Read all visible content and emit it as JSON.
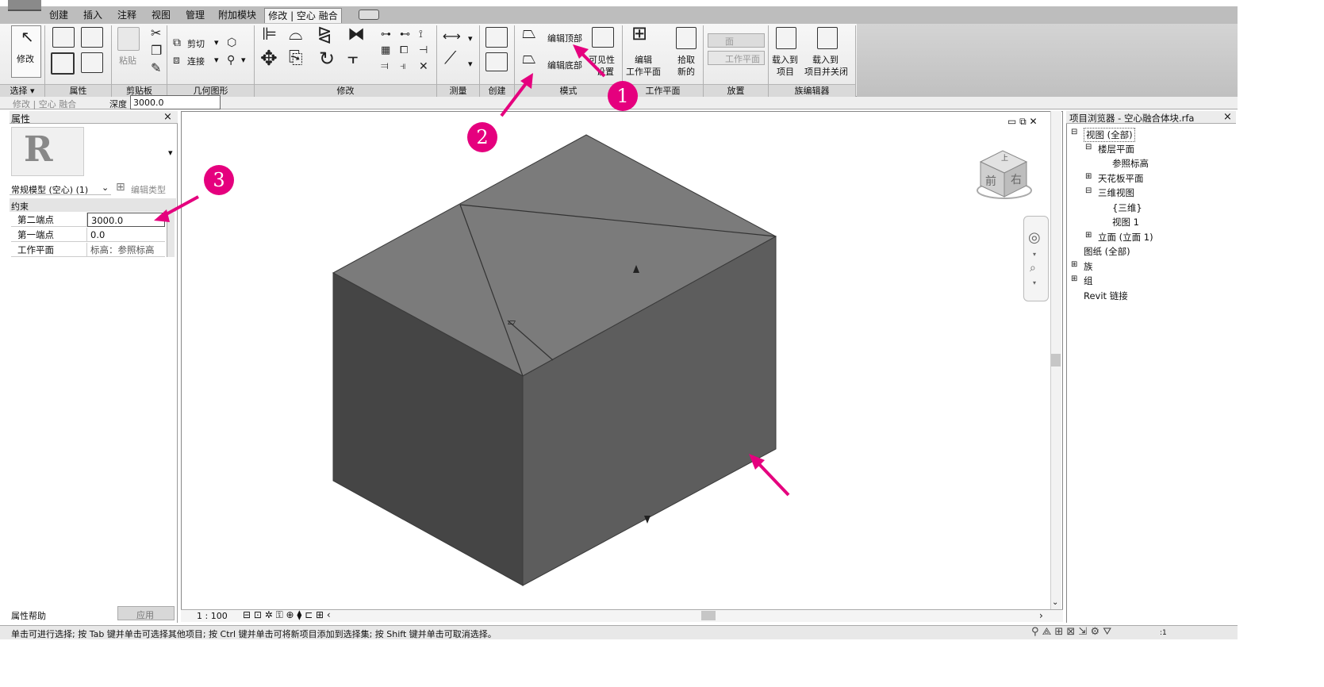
{
  "ribbon": {
    "tabs": [
      "创建",
      "插入",
      "注释",
      "视图",
      "管理",
      "附加模块",
      "修改 | 空心 融合"
    ],
    "buttons": {
      "modify": "修改",
      "paste": "粘贴",
      "cut": "剪切",
      "join": "连接",
      "edit_top": "编辑顶部",
      "edit_bottom": "编辑底部",
      "visibility": "可见性",
      "visibility_settings": "设置",
      "edit_workplane_1": "编辑",
      "edit_workplane_2": "工作平面",
      "pick_new_1": "拾取",
      "pick_new_2": "新的",
      "face": "面",
      "workplane_place": "工作平面",
      "load_project_1": "载入到",
      "load_project_2": "项目",
      "load_close_1": "载入到",
      "load_close_2": "项目并关闭"
    },
    "groups": {
      "select": "选择 ▾",
      "properties": "属性",
      "clipboard": "剪贴板",
      "geometry": "几何图形",
      "modify": "修改",
      "measure": "测量",
      "create": "创建",
      "mode": "模式",
      "workplane": "工作平面",
      "place": "放置",
      "family_editor": "族编辑器"
    }
  },
  "options_bar": {
    "context": "修改 | 空心 融合",
    "depth_label": "深度",
    "depth_value": "3000.0"
  },
  "properties": {
    "title": "属性",
    "close": "×",
    "type_selector": "常规模型 (空心) (1)",
    "edit_type": "编辑类型",
    "section": "约束",
    "rows": [
      {
        "name": "第二端点",
        "value": "3000.0"
      },
      {
        "name": "第一端点",
        "value": "0.0"
      },
      {
        "name": "工作平面",
        "value": "标高：参照标高"
      }
    ],
    "help": "属性帮助",
    "apply": "应用"
  },
  "viewport": {
    "window_controls": "▭ ⧉ ✕",
    "viewcube_top": "上",
    "viewcube_front": "前",
    "viewcube_right": "右",
    "scale": "1 : 100"
  },
  "browser": {
    "title": "项目浏览器 - 空心融合体块.rfa",
    "close": "×",
    "items": [
      {
        "label": "视图 (全部)",
        "level": 0,
        "toggle": "⊟"
      },
      {
        "label": "楼层平面",
        "level": 1,
        "toggle": "⊟"
      },
      {
        "label": "参照标高",
        "level": 2,
        "toggle": ""
      },
      {
        "label": "天花板平面",
        "level": 1,
        "toggle": "⊞"
      },
      {
        "label": "三维视图",
        "level": 1,
        "toggle": "⊟"
      },
      {
        "label": "{三维}",
        "level": 2,
        "toggle": ""
      },
      {
        "label": "视图 1",
        "level": 2,
        "toggle": ""
      },
      {
        "label": "立面 (立面 1)",
        "level": 1,
        "toggle": "⊞"
      },
      {
        "label": "图纸 (全部)",
        "level": 0,
        "toggle": ""
      },
      {
        "label": "族",
        "level": 0,
        "toggle": "⊞"
      },
      {
        "label": "组",
        "level": 0,
        "toggle": "⊞"
      },
      {
        "label": "Revit 链接",
        "level": 0,
        "toggle": ""
      }
    ]
  },
  "status_bar": {
    "text": "单击可进行选择; 按 Tab 键并单击可选择其他项目; 按 Ctrl 键并单击可将新项目添加到选择集; 按 Shift 键并单击可取消选择。",
    "filter_count": ":1"
  },
  "callouts": [
    "1",
    "2",
    "3"
  ],
  "colors": {
    "callout": "#e5007e",
    "ribbon_bg": "#f2f2f2",
    "tab_bar_bg": "#bdbdbd",
    "panel_header": "#d9d9d9",
    "box_top": "#7b7b7b",
    "box_left": "#454545",
    "box_right": "#5d5d5d"
  }
}
